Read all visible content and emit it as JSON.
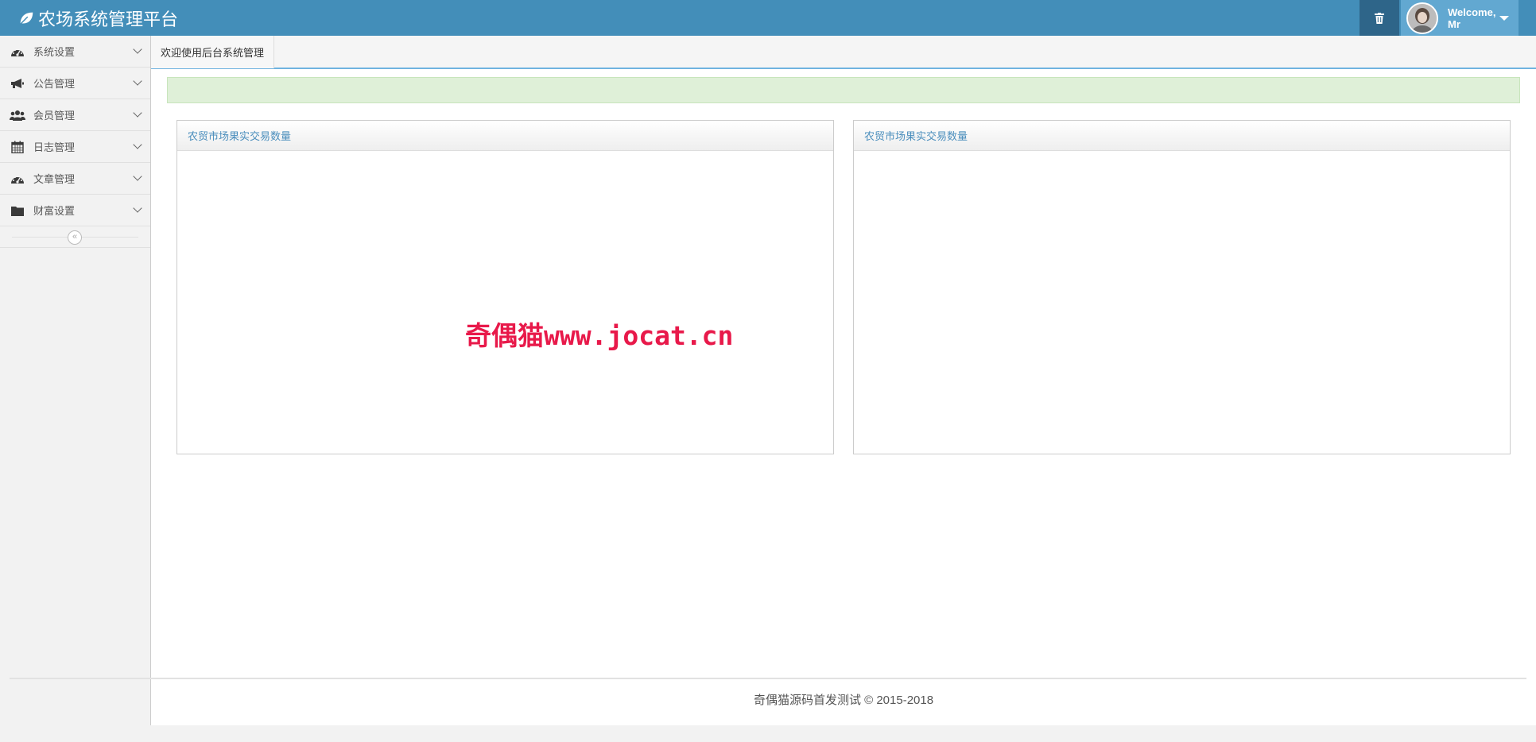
{
  "header": {
    "title": "农场系统管理平台",
    "brand_icon": "leaf-icon",
    "trash_icon": "trash-icon",
    "user": {
      "greeting": "Welcome,",
      "name": "Mr"
    }
  },
  "colors": {
    "navbar": "#438eb9",
    "user_area": "#62a8d1",
    "trash_area": "#2e6589",
    "panel_title": "#4c8fbd",
    "alert_bg": "#dff0d8",
    "watermark": "#e8194a"
  },
  "sidebar": {
    "items": [
      {
        "label": "系统设置",
        "icon": "dashboard-icon"
      },
      {
        "label": "公告管理",
        "icon": "bullhorn-icon"
      },
      {
        "label": "会员管理",
        "icon": "users-icon"
      },
      {
        "label": "日志管理",
        "icon": "calendar-icon"
      },
      {
        "label": "文章管理",
        "icon": "dashboard-icon"
      },
      {
        "label": "财富设置",
        "icon": "folder-icon"
      }
    ],
    "collapse_glyph": "«"
  },
  "main": {
    "tab_label": "欢迎使用后台系统管理",
    "panels": [
      {
        "title": "农贸市场果实交易数量"
      },
      {
        "title": "农贸市场果实交易数量"
      }
    ]
  },
  "watermark": "奇偶猫www.jocat.cn",
  "footer": {
    "text": "奇偶猫源码首发测试 © 2015-2018"
  }
}
